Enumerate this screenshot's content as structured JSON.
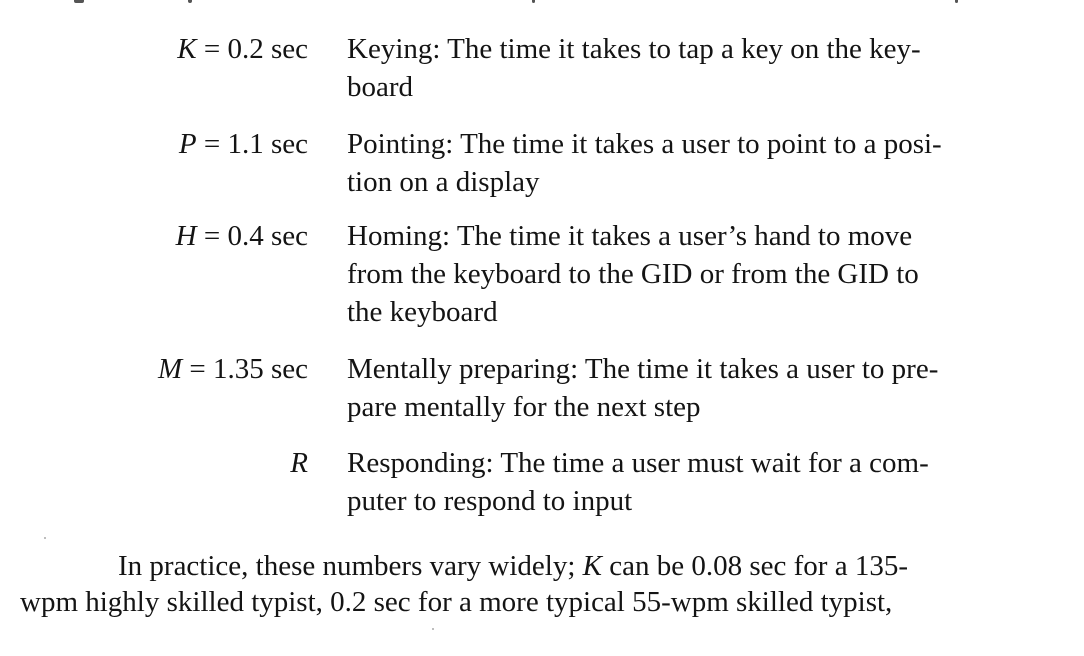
{
  "definitions": [
    {
      "symbol": "K",
      "value": " = 0.2 sec",
      "lines": [
        "Keying: The time it takes to tap a key on the key-",
        "board"
      ]
    },
    {
      "symbol": "P",
      "value": " = 1.1 sec",
      "lines": [
        "Pointing: The time it takes a user to point to a posi-",
        "tion on a display"
      ]
    },
    {
      "symbol": "H",
      "value": " = 0.4 sec",
      "lines": [
        "Homing: The time it takes a user’s hand to move",
        "from the keyboard to the GID or from the GID to",
        "the keyboard"
      ]
    },
    {
      "symbol": "M",
      "value": " = 1.35 sec",
      "lines": [
        "Mentally preparing: The time it takes a user to pre-",
        "pare mentally for the next step"
      ]
    },
    {
      "symbol": "R",
      "value": "",
      "lines": [
        "Responding: The time a user must wait for a com-",
        "puter to respond to input"
      ]
    }
  ],
  "paragraph": {
    "line1_pre": "In practice, these numbers vary widely; ",
    "line1_symbol": "K",
    "line1_post": " can be 0.08 sec for a 135-",
    "line2": "wpm highly skilled typist, 0.2 sec for a more typical 55-wpm skilled typist,"
  }
}
